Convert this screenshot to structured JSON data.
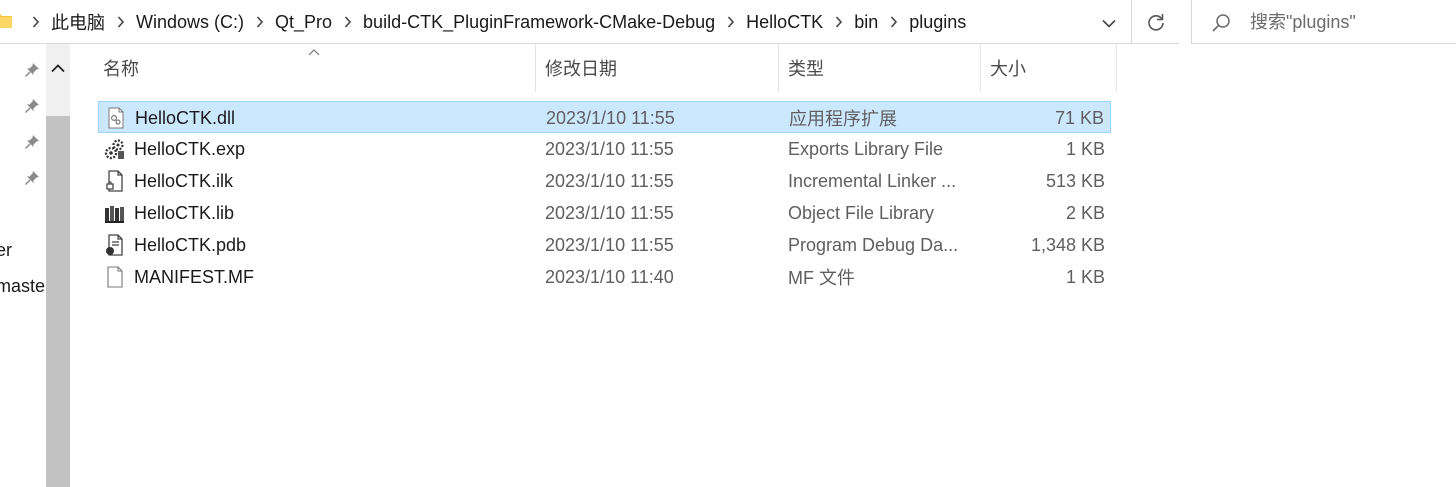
{
  "address_bar": {
    "breadcrumbs": [
      "此电脑",
      "Windows (C:)",
      "Qt_Pro",
      "build-CTK_PluginFramework-CMake-Debug",
      "HelloCTK",
      "bin",
      "plugins"
    ]
  },
  "search": {
    "placeholder": "搜索\"plugins\""
  },
  "nav_pane": {
    "partial_items": [
      "er",
      "maste"
    ]
  },
  "columns": {
    "name": "名称",
    "date": "修改日期",
    "type": "类型",
    "size": "大小"
  },
  "files": [
    {
      "icon": "dll-file-icon",
      "name": "HelloCTK.dll",
      "date": "2023/1/10 11:55",
      "type": "应用程序扩展",
      "size": "71 KB",
      "selected": true
    },
    {
      "icon": "exp-file-icon",
      "name": "HelloCTK.exp",
      "date": "2023/1/10 11:55",
      "type": "Exports Library File",
      "size": "1 KB",
      "selected": false
    },
    {
      "icon": "ilk-file-icon",
      "name": "HelloCTK.ilk",
      "date": "2023/1/10 11:55",
      "type": "Incremental Linker ...",
      "size": "513 KB",
      "selected": false
    },
    {
      "icon": "lib-file-icon",
      "name": "HelloCTK.lib",
      "date": "2023/1/10 11:55",
      "type": "Object File Library",
      "size": "2 KB",
      "selected": false
    },
    {
      "icon": "pdb-file-icon",
      "name": "HelloCTK.pdb",
      "date": "2023/1/10 11:55",
      "type": "Program Debug Da...",
      "size": "1,348 KB",
      "selected": false
    },
    {
      "icon": "generic-file-icon",
      "name": "MANIFEST.MF",
      "date": "2023/1/10 11:40",
      "type": "MF 文件",
      "size": "1 KB",
      "selected": false
    }
  ],
  "colors": {
    "selection_fill": "#cce8ff",
    "selection_border": "#99d1ff",
    "folder_yellow": "#f5c542"
  }
}
